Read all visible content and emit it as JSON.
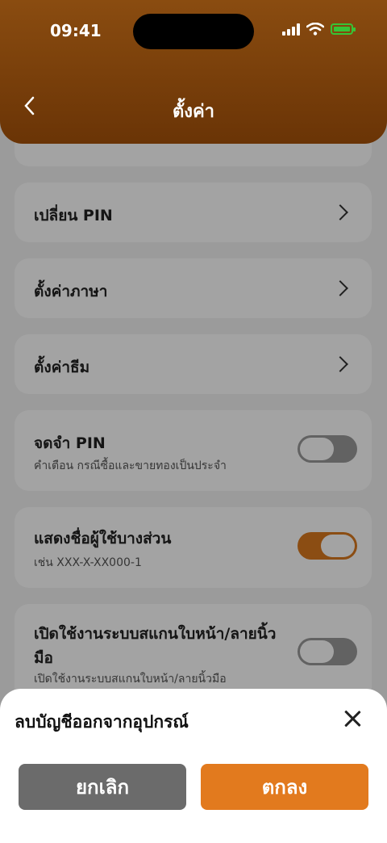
{
  "status_bar": {
    "time": "09:41"
  },
  "header": {
    "title": "ตั้งค่า"
  },
  "settings": [
    {
      "label": "เปลี่ยน PIN"
    },
    {
      "label": "ตั้งค่าภาษา"
    },
    {
      "label": "ตั้งค่าธีม"
    }
  ],
  "toggles": [
    {
      "label": "จดจำ PIN",
      "sub": "คำเตือน กรณีซื้อและขายทองเป็นประจำ",
      "on": false
    },
    {
      "label": "แสดงชื่อผู้ใช้บางส่วน",
      "sub": "เช่น XXX-X-XX000-1",
      "on": true
    },
    {
      "label": "เปิดใช้งานระบบสแกนใบหน้า/ลายนิ้วมือ",
      "sub": "เปิดใช้งานระบบสแกนใบหน้า/ลายนิ้วมือ",
      "on": false
    }
  ],
  "dialog": {
    "title": "ลบบัญชีออกจากอุปกรณ์",
    "cancel_label": "ยกเลิก",
    "confirm_label": "ตกลง"
  },
  "colors": {
    "accent": "#e27a1e",
    "header": "#7a400b",
    "cancel": "#6b6b6b"
  }
}
